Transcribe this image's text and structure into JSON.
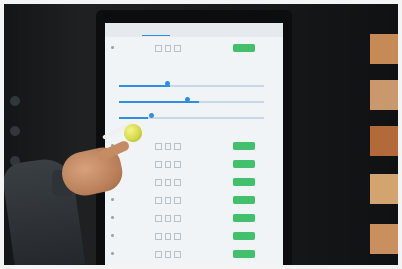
{
  "scene": {
    "description_tags": [
      "kiosk",
      "touchscreen",
      "hand",
      "stylus"
    ],
    "colors": {
      "frame_border": "#f4f4f4",
      "screen_bg": "#f1f4f7",
      "accent": "#2f8de4",
      "add_button": "#43c06b",
      "stylus_ball": "#d7d84a",
      "right_panels": "#c58a56"
    }
  },
  "screen": {
    "tabs": [
      {
        "label": ""
      },
      {
        "label": ""
      },
      {
        "label": ""
      },
      {
        "label": ""
      }
    ],
    "rows": [
      {
        "label": ""
      },
      {
        "label": ""
      },
      {
        "label": ""
      },
      {
        "label": ""
      },
      {
        "label": ""
      },
      {
        "label": ""
      },
      {
        "label": ""
      },
      {
        "label": ""
      }
    ],
    "sliders": [
      {
        "fill": 0.35
      },
      {
        "fill": 0.55
      },
      {
        "fill": 0.2
      }
    ]
  }
}
